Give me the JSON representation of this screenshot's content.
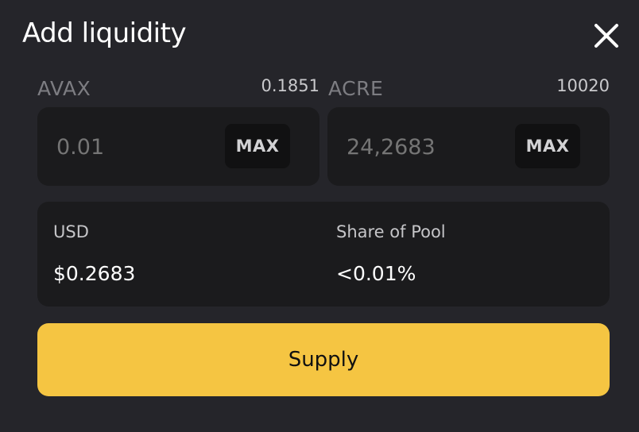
{
  "modal": {
    "title": "Add liquidity"
  },
  "tokens": [
    {
      "symbol": "AVAX",
      "balance": "0.1851",
      "amount": "0.01",
      "max_label": "MAX"
    },
    {
      "symbol": "ACRE",
      "balance": "10020",
      "amount": "24,2683",
      "max_label": "MAX"
    }
  ],
  "summary": {
    "usd_label": "USD",
    "usd_value": "$0.2683",
    "share_label": "Share of Pool",
    "share_value": "<0.01%"
  },
  "actions": {
    "supply_label": "Supply"
  },
  "colors": {
    "background": "#25252a",
    "panel": "#1b1b1d",
    "accent": "#f5c542"
  },
  "icons": {
    "close": "close-icon"
  }
}
